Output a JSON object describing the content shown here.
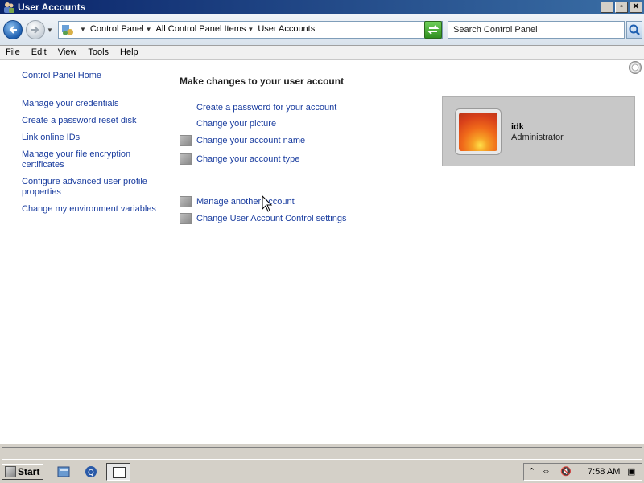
{
  "window": {
    "title": "User Accounts"
  },
  "icons": {
    "app": "user-accounts-icon",
    "back": "back-arrow-icon",
    "forward": "forward-arrow-icon",
    "refresh": "refresh-icon",
    "search": "search-icon",
    "help": "help-icon"
  },
  "addressbar": {
    "crumbs": [
      "Control Panel",
      "All Control Panel Items",
      "User Accounts"
    ]
  },
  "search": {
    "placeholder": "Search Control Panel"
  },
  "menu": [
    "File",
    "Edit",
    "View",
    "Tools",
    "Help"
  ],
  "leftnav": {
    "home": "Control Panel Home",
    "links": [
      "Manage your credentials",
      "Create a password reset disk",
      "Link online IDs",
      "Manage your file encryption certificates",
      "Configure advanced user profile properties",
      "Change my environment variables"
    ]
  },
  "main": {
    "heading": "Make changes to your user account",
    "tasks": [
      {
        "label": "Create a password for your account",
        "shield": false
      },
      {
        "label": "Change your picture",
        "shield": false
      },
      {
        "label": "Change your account name",
        "shield": true
      },
      {
        "label": "Change your account type",
        "shield": true
      }
    ],
    "other_tasks": [
      {
        "label": "Manage another account",
        "shield": true
      },
      {
        "label": "Change User Account Control settings",
        "shield": true
      }
    ]
  },
  "user": {
    "name": "idk",
    "role": "Administrator"
  },
  "taskbar": {
    "start": "Start",
    "clock": "7:58 AM"
  }
}
